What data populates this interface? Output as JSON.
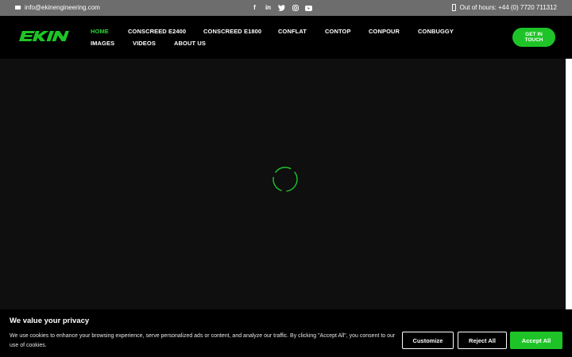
{
  "topbar": {
    "email": "info@ekinengineering.com",
    "hours": "Out of hours: +44 (0) 7720 711312",
    "social": [
      "facebook-icon",
      "linkedin-icon",
      "twitter-icon",
      "instagram-icon",
      "youtube-icon"
    ]
  },
  "header": {
    "logo_text": "EKIN",
    "nav": [
      "HOME",
      "CONSCREED E2400",
      "CONSCREED E1800",
      "CONFLAT",
      "CONTOP",
      "CONPOUR",
      "CONBUGGY",
      "IMAGES",
      "VIDEOS",
      "ABOUT US"
    ],
    "active": "HOME",
    "cta_line1": "GET IN",
    "cta_line2": "TOUCH"
  },
  "cookie": {
    "title": "We value your privacy",
    "message": "We use cookies to enhance your browsing experience, serve personalized ads or content, and analyze our traffic. By clicking \"Accept All\", you consent to our use of cookies.",
    "customize": "Customize",
    "reject": "Reject All",
    "accept": "Accept All"
  },
  "colors": {
    "accent": "#1ec427",
    "topbar": "#6d6d6d",
    "background": "#0f0f10"
  }
}
